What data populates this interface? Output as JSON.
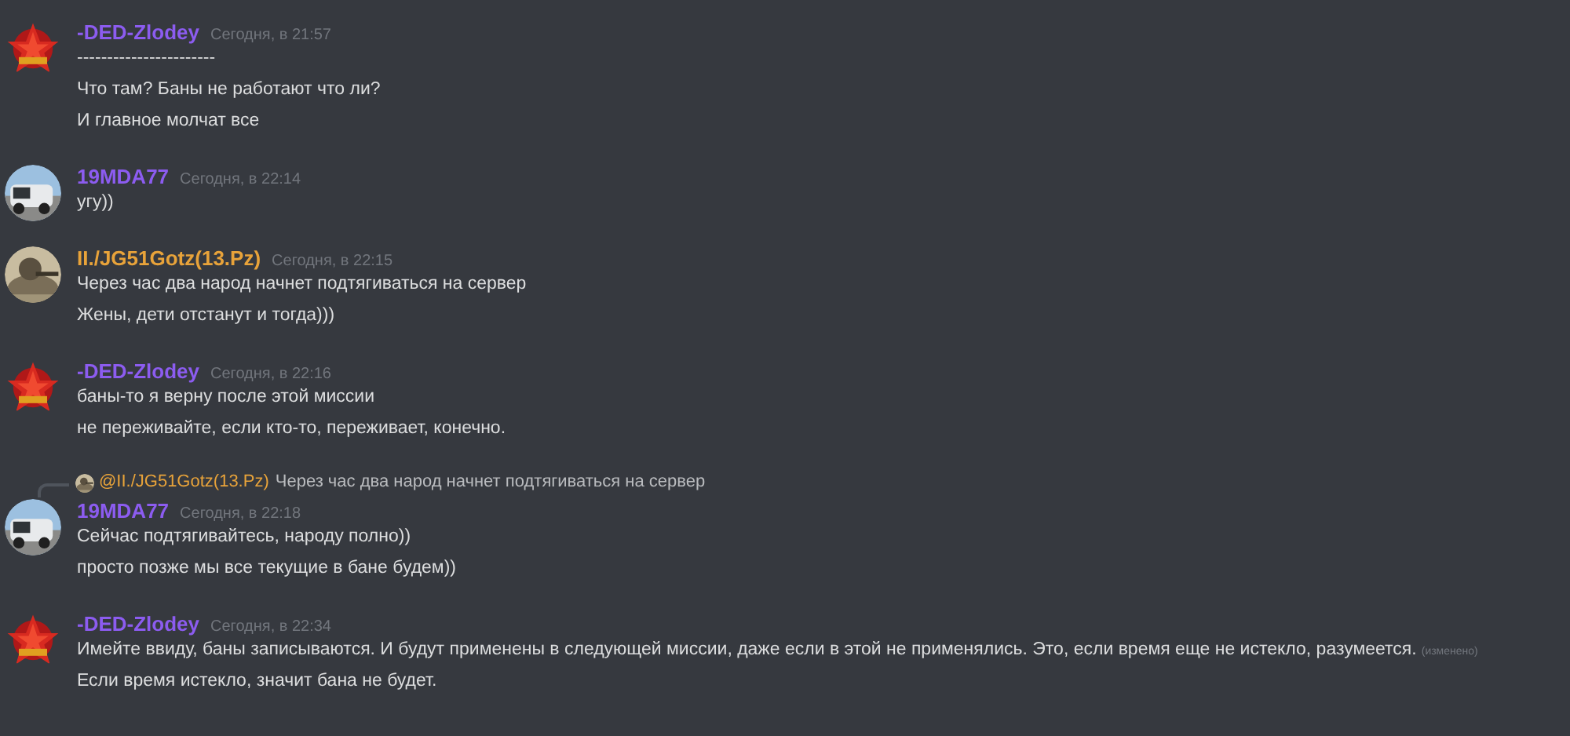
{
  "messages": [
    {
      "author": "-DED-Zlodey",
      "color": "#8c5cf0",
      "timestamp": "Сегодня, в 21:57",
      "lines": [
        "-----------------------",
        "Что там? Баны не работают что ли?",
        "И главное молчат все"
      ]
    },
    {
      "author": "19MDA77",
      "color": "#8c5cf0",
      "timestamp": "Сегодня, в 22:14",
      "lines": [
        "угу))"
      ]
    },
    {
      "author": "II./JG51Gotz(13.Pz)",
      "color": "#e8a33a",
      "timestamp": "Сегодня, в 22:15",
      "lines": [
        "Через час два народ начнет подтягиваться на сервер",
        "Жены, дети отстанут и тогда)))"
      ]
    },
    {
      "author": "-DED-Zlodey",
      "color": "#8c5cf0",
      "timestamp": "Сегодня, в 22:16",
      "lines": [
        "баны-то я верну после этой миссии",
        "не переживайте, если кто-то, переживает, конечно."
      ]
    },
    {
      "author": "19MDA77",
      "color": "#8c5cf0",
      "timestamp": "Сегодня, в 22:18",
      "reply": {
        "author": "@II./JG51Gotz(13.Pz)",
        "color": "#e8a33a",
        "text": "Через час два народ начнет подтягиваться на сервер"
      },
      "lines": [
        "Сейчас подтягивайтесь, народу полно))",
        "просто позже мы все текущие в бане будем))"
      ]
    },
    {
      "author": "-DED-Zlodey",
      "color": "#8c5cf0",
      "timestamp": "Сегодня, в 22:34",
      "edited": "(изменено)",
      "lines": [
        "Имейте ввиду, баны записываются. И будут применены в следующей миссии, даже если в этой не применялись. Это, если время еще не истекло, разумеется.",
        "Если время истекло, значит бана не будет."
      ]
    }
  ]
}
